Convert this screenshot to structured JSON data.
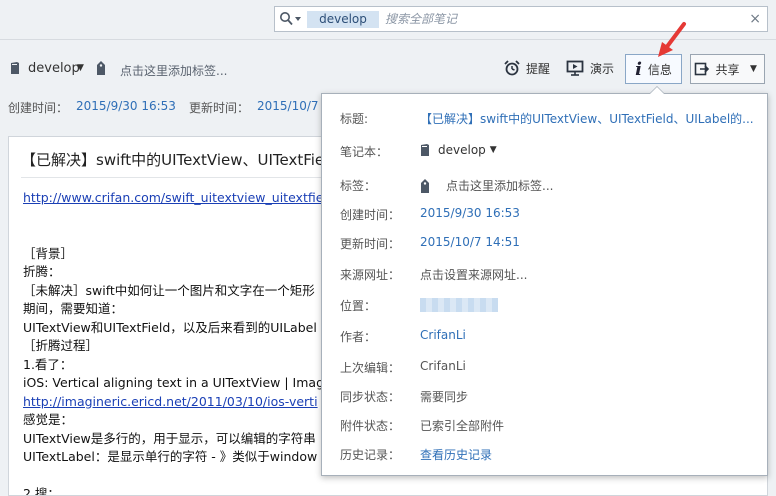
{
  "search": {
    "scope": "develop",
    "placeholder": "搜索全部笔记",
    "clear_label": "×"
  },
  "toolbar": {
    "notebook": "develop",
    "tag_placeholder": "点击这里添加标签...",
    "reminder_label": "提醒",
    "present_label": "演示",
    "info_label": "信息",
    "share_label": "共享"
  },
  "meta": {
    "created_label": "创建时间：",
    "created_value": "2015/9/30 16:53",
    "updated_label": "更新时间：",
    "updated_value": "2015/10/7"
  },
  "note": {
    "title": "【已解决】swift中的UITextView、UITextFie",
    "lines": [
      {
        "text": "http://www.crifan.com/swift_uitextview_uitextfie",
        "link": true
      },
      {
        "text": "",
        "link": false
      },
      {
        "text": "",
        "link": false
      },
      {
        "text": "［背景］",
        "link": false
      },
      {
        "text": "折腾：",
        "link": false
      },
      {
        "text": "［未解决］swift中如何让一个图片和文字在一个矩形",
        "link": false
      },
      {
        "text": "期间，需要知道：",
        "link": false
      },
      {
        "text": "UITextView和UITextField，以及后来看到的UILabel",
        "link": false
      },
      {
        "text": "［折腾过程］",
        "link": false
      },
      {
        "text": "1.看了：",
        "link": false
      },
      {
        "text": "iOS: Vertical aligning text in a UITextView | Imagi",
        "link": false
      },
      {
        "text": "http://imagineric.ericd.net/2011/03/10/ios-verti",
        "link": true
      },
      {
        "text": "感觉是：",
        "link": false
      },
      {
        "text": "UITextView是多行的，用于显示，可以编辑的字符串",
        "link": false
      },
      {
        "text": "UITextLabel：是显示单行的字符 - 》类似于window",
        "link": false
      },
      {
        "text": "",
        "link": false
      },
      {
        "text": "2.搜：",
        "link": false
      }
    ]
  },
  "info_panel": {
    "title_label": "标题:",
    "title_value": "【已解决】swift中的UITextView、UITextField、UILabel的...",
    "notebook_label": "笔记本：",
    "notebook_value": "develop",
    "tags_label": "标签：",
    "tags_value": "点击这里添加标签...",
    "created_label": "创建时间：",
    "created_value": "2015/9/30 16:53",
    "updated_label": "更新时间：",
    "updated_value": "2015/10/7 14:51",
    "source_label": "来源网址：",
    "source_value": "点击设置来源网址...",
    "location_label": "位置：",
    "author_label": "作者：",
    "author_value": "CrifanLi",
    "last_edit_label": "上次编辑：",
    "last_edit_value": "CrifanLi",
    "sync_label": "同步状态：",
    "sync_value": "需要同步",
    "attach_label": "附件状态：",
    "attach_value": "已索引全部附件",
    "history_label": "历史记录：",
    "history_value": "查看历史记录"
  },
  "colors": {
    "link_blue": "#2f6fb7",
    "background": "#eef1f4",
    "arrow_red": "#e53935"
  }
}
